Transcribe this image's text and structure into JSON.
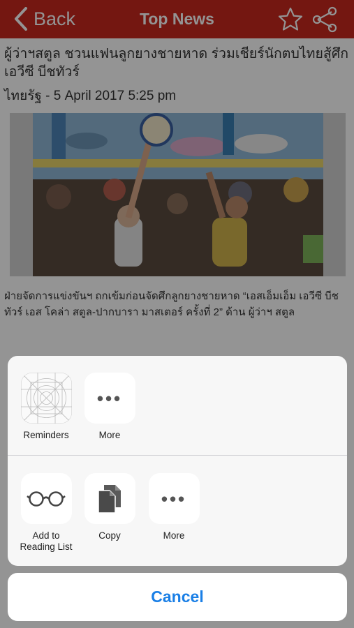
{
  "navbar": {
    "back_label": "Back",
    "title": "Top News",
    "background": "#c8281e"
  },
  "icons": {
    "back": "chevron-left-icon",
    "star": "star-icon",
    "share": "share-icon",
    "reminders": "reminders-grid-icon",
    "more": "more-dots-icon",
    "reading_list": "glasses-icon",
    "copy": "copy-documents-icon"
  },
  "article": {
    "headline": "ผู้ว่าฯสตูล ชวนแฟนลูกยางชายหาด ร่วมเชียร์นักตบไทยสู้ศึกเอวีซี บีชทัวร์",
    "byline": "ไทยรัฐ - 5 April 2017 5:25 pm",
    "caption": "ฝ่ายจัดการแข่งขันฯ ถกเข้มก่อนจัดศึกลูกยางชายหาด “เอสเอ็มเอ็ม เอวีซี บีชทัวร์ เอส โคล่า สตูล-ปากบารา มาสเตอร์ ครั้งที่ 2” ด้าน ผู้ว่าฯ สตูล"
  },
  "share_sheet": {
    "apps": [
      {
        "label": "Reminders"
      },
      {
        "label": "More",
        "glyph": "•••"
      }
    ],
    "actions": [
      {
        "label": "Add to Reading List"
      },
      {
        "label": "Copy"
      },
      {
        "label": "More",
        "glyph": "•••"
      }
    ],
    "cancel_label": "Cancel",
    "cancel_color": "#1a7fe6"
  }
}
